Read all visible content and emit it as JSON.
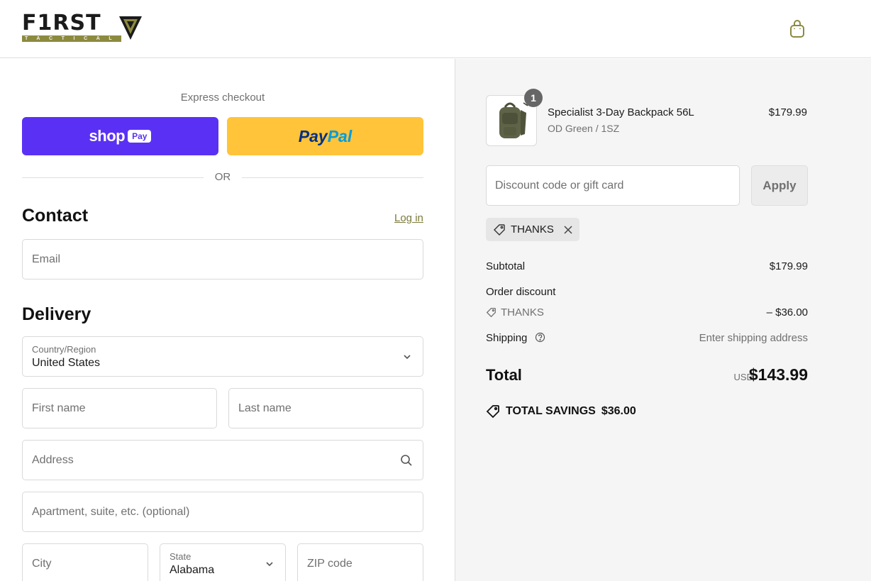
{
  "header": {
    "logo": {
      "wordmark": "F1RST",
      "tagline": "TACTICAL"
    },
    "cart_icon": "shopping-bag-icon"
  },
  "express": {
    "label": "Express checkout",
    "shop_pay": {
      "word": "shop",
      "pill": "Pay"
    },
    "paypal": {
      "part1": "Pay",
      "part2": "Pal"
    },
    "divider": "OR"
  },
  "contact": {
    "heading": "Contact",
    "login_link": "Log in",
    "email_placeholder": "Email"
  },
  "delivery": {
    "heading": "Delivery",
    "country": {
      "label": "Country/Region",
      "value": "United States"
    },
    "first_name_placeholder": "First name",
    "last_name_placeholder": "Last name",
    "address_placeholder": "Address",
    "apartment_placeholder": "Apartment, suite, etc. (optional)",
    "city_placeholder": "City",
    "state": {
      "label": "State",
      "value": "Alabama"
    },
    "zip_placeholder": "ZIP code"
  },
  "summary": {
    "item": {
      "quantity": "1",
      "name": "Specialist 3-Day Backpack 56L",
      "variant": "OD Green / 1SZ",
      "price": "$179.99"
    },
    "discount_placeholder": "Discount code or gift card",
    "apply_label": "Apply",
    "applied_code": "THANKS",
    "subtotal_label": "Subtotal",
    "subtotal_value": "$179.99",
    "order_discount_label": "Order discount",
    "order_discount_code": "THANKS",
    "order_discount_value": "– $36.00",
    "shipping_label": "Shipping",
    "shipping_value": "Enter shipping address",
    "total_label": "Total",
    "total_currency": "USD",
    "total_value": "$143.99",
    "savings_label": "TOTAL SAVINGS",
    "savings_value": "$36.00"
  },
  "colors": {
    "shop_pay": "#5a31f4",
    "paypal": "#ffc439",
    "brand_olive": "#8c8a3f",
    "summary_bg": "#f5f5f5"
  }
}
